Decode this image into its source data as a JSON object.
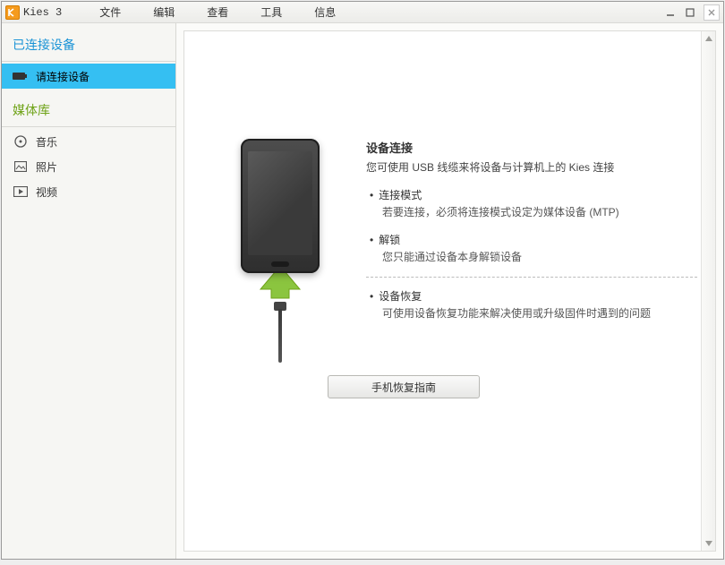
{
  "app": {
    "title": "Kies 3"
  },
  "menu": {
    "file": "文件",
    "edit": "编辑",
    "view": "查看",
    "tools": "工具",
    "info": "信息"
  },
  "sidebar": {
    "connected_header": "已连接设备",
    "connect_prompt": "请连接设备",
    "library_header": "媒体库",
    "items": {
      "music": "音乐",
      "photos": "照片",
      "videos": "视频"
    }
  },
  "main": {
    "heading": "设备连接",
    "subtitle": "您可使用 USB 线缆来将设备与计算机上的 Kies 连接",
    "bullets": [
      {
        "title": "连接模式",
        "desc": "若要连接，必须将连接模式设定为媒体设备 (MTP)"
      },
      {
        "title": "解锁",
        "desc": "您只能通过设备本身解锁设备"
      }
    ],
    "recovery": {
      "title": "设备恢复",
      "desc": "可使用设备恢复功能来解决使用或升级固件时遇到的问题"
    },
    "button": "手机恢复指南"
  }
}
